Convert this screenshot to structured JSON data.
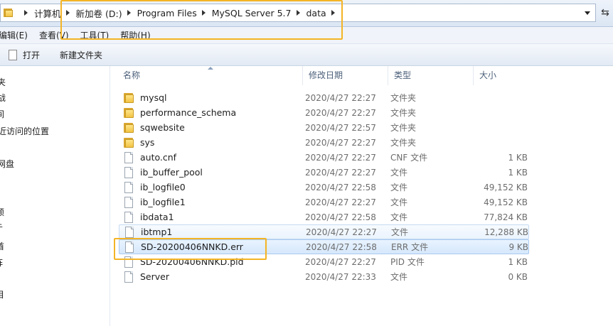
{
  "address": {
    "crumbs": [
      "计算机",
      "新加卷 (D:)",
      "Program Files",
      "MySQL Server 5.7",
      "data"
    ]
  },
  "menu": [
    "编辑(E)",
    "查看(V)",
    "工具(T)",
    "帮助(H)"
  ],
  "toolbar": {
    "open_label": "打开",
    "new_folder_label": "新建文件夹"
  },
  "nav": [
    "夹",
    "战",
    "间",
    "近访问的位置",
    "网盘",
    "顿",
    "亍",
    "酋",
    "阵",
    "目"
  ],
  "columns": {
    "name": "名称",
    "date": "修改日期",
    "type": "类型",
    "size": "大小"
  },
  "files": [
    {
      "name": "mysql",
      "date": "2020/4/27 22:27",
      "type": "文件夹",
      "size": "",
      "icon": "folder-icon"
    },
    {
      "name": "performance_schema",
      "date": "2020/4/27 22:27",
      "type": "文件夹",
      "size": "",
      "icon": "folder-icon"
    },
    {
      "name": "sqwebsite",
      "date": "2020/4/27 22:57",
      "type": "文件夹",
      "size": "",
      "icon": "folder-icon"
    },
    {
      "name": "sys",
      "date": "2020/4/27 22:27",
      "type": "文件夹",
      "size": "",
      "icon": "folder-icon"
    },
    {
      "name": "auto.cnf",
      "date": "2020/4/27 22:27",
      "type": "CNF 文件",
      "size": "1 KB",
      "icon": "file-icon"
    },
    {
      "name": "ib_buffer_pool",
      "date": "2020/4/27 22:27",
      "type": "文件",
      "size": "1 KB",
      "icon": "file-icon"
    },
    {
      "name": "ib_logfile0",
      "date": "2020/4/27 22:58",
      "type": "文件",
      "size": "49,152 KB",
      "icon": "file-icon"
    },
    {
      "name": "ib_logfile1",
      "date": "2020/4/27 22:27",
      "type": "文件",
      "size": "49,152 KB",
      "icon": "file-icon"
    },
    {
      "name": "ibdata1",
      "date": "2020/4/27 22:58",
      "type": "文件",
      "size": "77,824 KB",
      "icon": "file-icon"
    },
    {
      "name": "ibtmp1",
      "date": "2020/4/27 22:27",
      "type": "文件",
      "size": "12,288 KB",
      "icon": "file-icon"
    },
    {
      "name": "SD-20200406NNKD.err",
      "date": "2020/4/27 22:58",
      "type": "ERR 文件",
      "size": "9 KB",
      "icon": "file-icon"
    },
    {
      "name": "SD-20200406NNKD.pid",
      "date": "2020/4/27 22:27",
      "type": "PID 文件",
      "size": "1 KB",
      "icon": "file-icon"
    },
    {
      "name": "Server",
      "date": "2020/4/27 22:33",
      "type": "文件",
      "size": "0 KB",
      "icon": "file-icon"
    }
  ],
  "highlight_color": "#f4b425"
}
